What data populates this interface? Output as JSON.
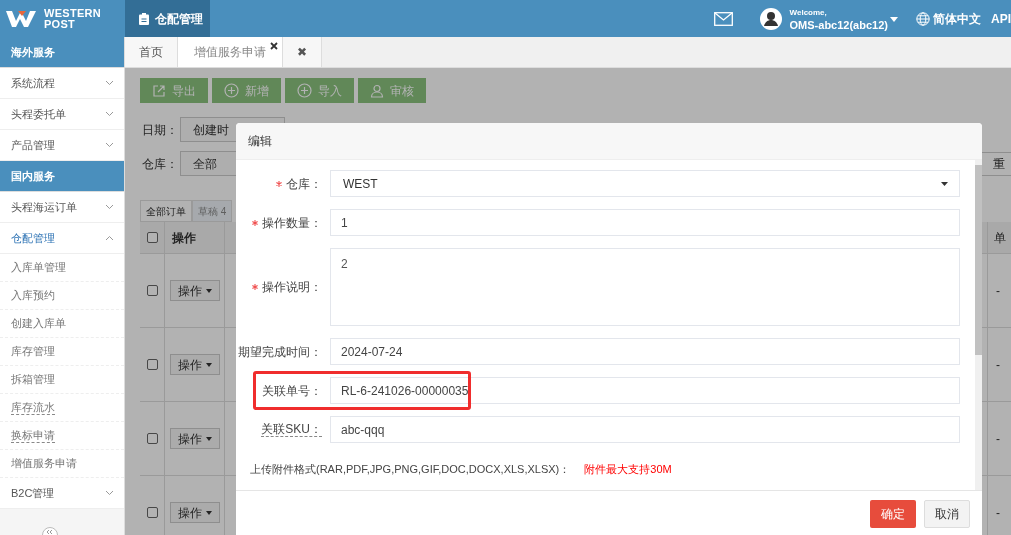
{
  "header": {
    "logo_line1": "WESTERN",
    "logo_line2": "POST",
    "module": "仓配管理",
    "welcome": "Welcome,",
    "user": "OMS-abc12(abc12)",
    "language": "简体中文",
    "api": "API"
  },
  "sidebar": [
    {
      "kind": "section",
      "label": "海外服务"
    },
    {
      "kind": "group",
      "label": "系统流程",
      "expanded": false
    },
    {
      "kind": "group",
      "label": "头程委托单",
      "expanded": false
    },
    {
      "kind": "group",
      "label": "产品管理",
      "expanded": false
    },
    {
      "kind": "section",
      "label": "国内服务"
    },
    {
      "kind": "group",
      "label": "头程海运订单",
      "expanded": false
    },
    {
      "kind": "group",
      "label": "仓配管理",
      "expanded": true,
      "children": [
        {
          "label": "入库单管理",
          "hint": false
        },
        {
          "label": "入库预约",
          "hint": false
        },
        {
          "label": "创建入库单",
          "hint": false
        },
        {
          "label": "库存管理",
          "hint": false
        },
        {
          "label": "拆箱管理",
          "hint": false
        },
        {
          "label": "库存流水",
          "hint": true
        },
        {
          "label": "换标申请",
          "hint": true
        },
        {
          "label": "增值服务申请",
          "hint": false
        }
      ]
    },
    {
      "kind": "group",
      "label": "B2C管理",
      "expanded": false
    }
  ],
  "tabs": [
    {
      "label": "首页",
      "selected": false,
      "closable": false
    },
    {
      "label": "增值服务申请",
      "selected": true,
      "closable": true
    },
    {
      "label": "✖",
      "selected": false,
      "closable": false
    }
  ],
  "toolbar": [
    {
      "label": "导出"
    },
    {
      "label": "新增"
    },
    {
      "label": "导入"
    },
    {
      "label": "审核"
    }
  ],
  "filters": [
    {
      "label": "日期：",
      "value": "创建时"
    },
    {
      "label": "仓库：",
      "value": "全部"
    }
  ],
  "reset_button": "重",
  "order_tabs": [
    {
      "label": "全部订单",
      "selected": true
    },
    {
      "label": "草稿 4",
      "selected": false
    }
  ],
  "table": {
    "columns": [
      "操作",
      "单"
    ],
    "header_checked": false,
    "rows": [
      {
        "checked": false,
        "action": "操作",
        "column_2": "-"
      },
      {
        "checked": false,
        "action": "操作",
        "column_2": "-"
      },
      {
        "checked": false,
        "action": "操作",
        "column_2": "-"
      },
      {
        "checked": false,
        "action": "操作",
        "column_2": "-"
      }
    ]
  },
  "dialog": {
    "title": "编辑",
    "fields": [
      {
        "kind": "select",
        "label": "仓库：",
        "required": true,
        "value": "WEST",
        "hint": false,
        "highlighted": false
      },
      {
        "kind": "input",
        "label": "操作数量：",
        "required": true,
        "value": "1",
        "hint": false,
        "highlighted": false
      },
      {
        "kind": "textarea",
        "label": "操作说明：",
        "required": true,
        "value": "2",
        "hint": false,
        "highlighted": false
      },
      {
        "kind": "input",
        "label": "期望完成时间：",
        "required": false,
        "value": "2024-07-24",
        "hint": false,
        "highlighted": false
      },
      {
        "kind": "input",
        "label": "关联单号：",
        "required": false,
        "value": "RL-6-241026-00000035",
        "hint": false,
        "highlighted": true
      },
      {
        "kind": "input",
        "label": "关联SKU：",
        "required": false,
        "value": "abc-qqq",
        "hint": true,
        "highlighted": false
      }
    ],
    "upload_note": "上传附件格式(RAR,PDF,JPG,PNG,GIF,DOC,DOCX,XLS,XLSX)：",
    "upload_limit": "附件最大支持30M",
    "buttons": [
      {
        "label": "确定",
        "kind": "primary"
      },
      {
        "label": "取消",
        "kind": "default"
      }
    ]
  }
}
